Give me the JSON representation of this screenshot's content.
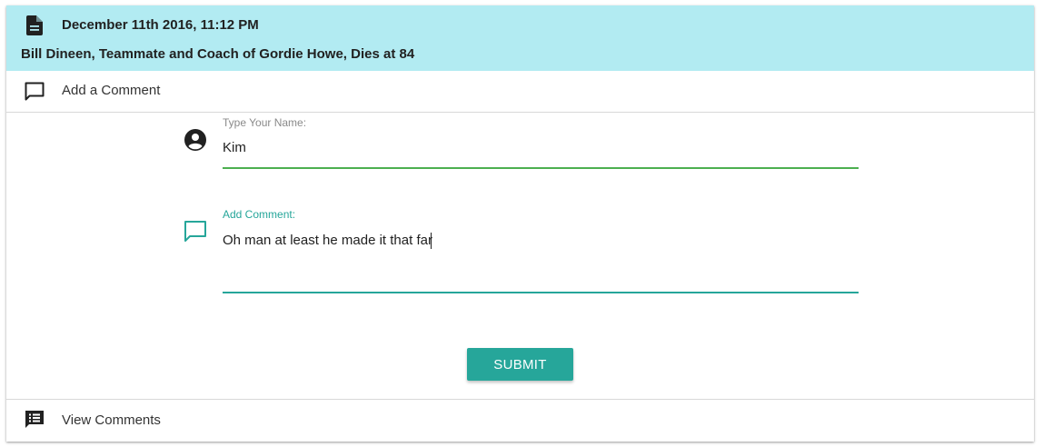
{
  "header": {
    "icon": "description-icon",
    "date": "December 11th 2016, 11:12 PM",
    "title": "Bill Dineen, Teammate and Coach of Gordie Howe, Dies at 84",
    "background": "#b2ebf2"
  },
  "add_comment_row": {
    "icon": "comment-outline-icon",
    "label": "Add a Comment"
  },
  "form": {
    "name_field": {
      "icon": "account-circle-icon",
      "label": "Type Your Name:",
      "value": "Kim",
      "underline_color": "#4caf50"
    },
    "comment_field": {
      "icon": "comment-outline-icon",
      "label": "Add Comment:",
      "value": "Oh man at least he made it that far",
      "accent_color": "#26a69a"
    },
    "submit_label": "SUBMIT",
    "submit_color": "#26a69a"
  },
  "view_comments_row": {
    "icon": "comment-list-icon",
    "label": "View Comments"
  }
}
